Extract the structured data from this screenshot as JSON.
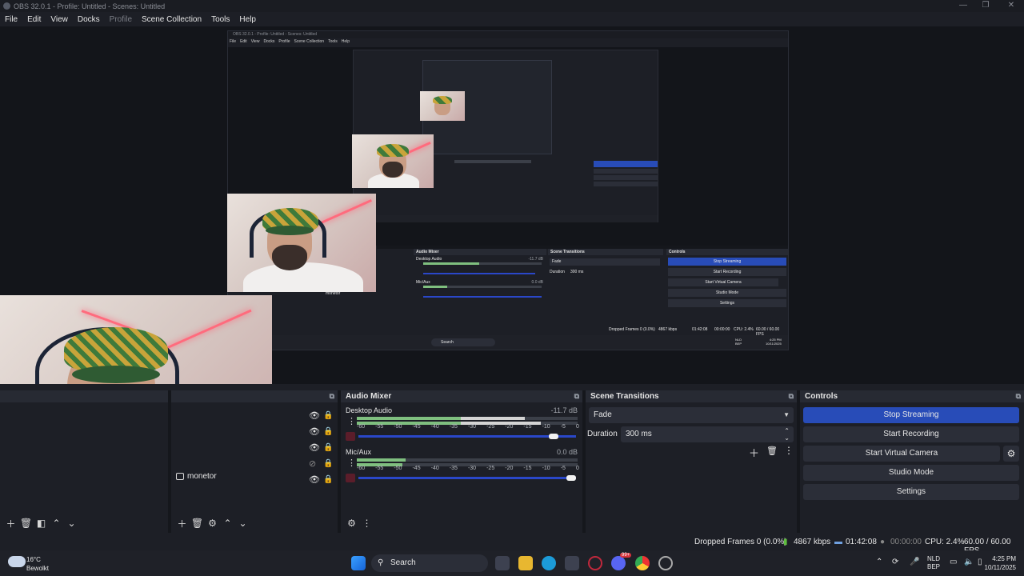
{
  "window": {
    "title": "OBS 32.0.1 - Profile: Untitled - Scenes: Untitled",
    "controls": [
      "—",
      "❐",
      "✕"
    ]
  },
  "menu": [
    "File",
    "Edit",
    "View",
    "Docks",
    "Profile",
    "Scene Collection",
    "Tools",
    "Help"
  ],
  "nested_preview": {
    "title": "OBS 32.0.1 - Profile: Untitled - Scenes: Untitled",
    "menu": [
      "File",
      "Edit",
      "View",
      "Docks",
      "Profile",
      "Scene Collection",
      "Tools",
      "Help"
    ],
    "audio_mixer_title": "Audio Mixer",
    "desktop_audio": "Desktop Audio",
    "desktop_db": "-11.7 dB",
    "mic": "Mic/Aux",
    "mic_db": "0.0 dB",
    "transitions_title": "Scene Transitions",
    "transition": "Fade",
    "duration_label": "Duration",
    "duration": "300 ms",
    "controls_title": "Controls",
    "buttons": [
      "Stop Streaming",
      "Start Recording",
      "Start Virtual Camera",
      "Studio Mode",
      "Settings"
    ],
    "source_label": "monetor",
    "status": {
      "dropped": "Dropped Frames 0 (0.0%)",
      "kbps": "4867 kbps",
      "time": "01:42:08",
      "rec": "00:00:00",
      "cpu": "CPU: 2.4%",
      "fps": "60.00 / 60.00 FPS"
    },
    "taskbar": {
      "search": "Search",
      "lang": "NLD",
      "lang2": "BEP",
      "time": "4:25 PM",
      "date": "10/11/2025"
    }
  },
  "sources": {
    "item_label": "monetor"
  },
  "audio_mixer": {
    "title": "Audio Mixer",
    "channels": [
      {
        "name": "Desktop Audio",
        "db": "-11.7 dB",
        "level": 0.55,
        "fader": 0.92
      },
      {
        "name": "Mic/Aux",
        "db": "0.0 dB",
        "level": 0.22,
        "fader": 1.0
      }
    ],
    "scale": [
      "-60",
      "-55",
      "-50",
      "-45",
      "-40",
      "-35",
      "-30",
      "-25",
      "-20",
      "-15",
      "-10",
      "-5",
      "0"
    ]
  },
  "scene_transitions": {
    "title": "Scene Transitions",
    "transition": "Fade",
    "duration_label": "Duration",
    "duration_value": "300 ms"
  },
  "controls": {
    "title": "Controls",
    "stop_streaming": "Stop Streaming",
    "start_recording": "Start Recording",
    "start_virtual_camera": "Start Virtual Camera",
    "studio_mode": "Studio Mode",
    "settings": "Settings"
  },
  "status_bar": {
    "dropped": "Dropped Frames 0 (0.0%)",
    "kbps": "4867 kbps",
    "stream_time": "01:42:08",
    "rec_time": "00:00:00",
    "cpu": "CPU: 2.4%",
    "fps": "60.00 / 60.00 FPS"
  },
  "taskbar": {
    "weather_temp": "16°C",
    "weather_desc": "Bewolkt",
    "search_placeholder": "Search",
    "lang_top": "NLD",
    "lang_bottom": "BEP",
    "time": "4:25 PM",
    "date": "10/11/2025",
    "discord_badge": "99+"
  },
  "colors": {
    "accent": "#284cb8",
    "fader": "#2a47c8",
    "panel": "#1d1f26",
    "header": "#272a33"
  }
}
